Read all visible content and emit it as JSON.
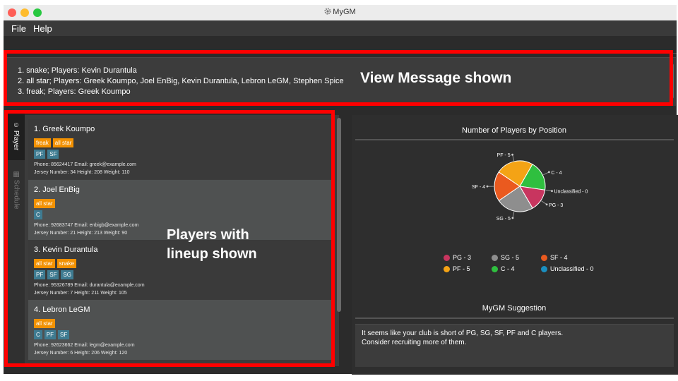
{
  "app": {
    "title": "MyGM",
    "icon": "gear-icon"
  },
  "menu": {
    "file": "File",
    "help": "Help"
  },
  "result": {
    "lines": "1. snake; Players: Kevin Durantula\n2. all star; Players: Greek Koumpo, Joel EnBig, Kevin Durantula, Lebron LeGM, Stephen Spice\n3. freak; Players: Greek Koumpo"
  },
  "annotations": {
    "view_message": "View Message shown",
    "players": "Players with\nlineup shown"
  },
  "sidebar": {
    "tabs": [
      {
        "label": "Player",
        "icon": "player-icon"
      },
      {
        "label": "Schedule",
        "icon": "schedule-icon"
      }
    ]
  },
  "players": [
    {
      "name": "1.  Greek Koumpo",
      "tags": [
        "freak",
        "all star"
      ],
      "positions": [
        "PF",
        "SF"
      ],
      "contact": "Phone: 85624417   Email: greek@example.com",
      "stats": "Jersey Number: 34   Height: 208   Weight: 110"
    },
    {
      "name": "2.  Joel EnBig",
      "tags": [
        "all star"
      ],
      "positions": [
        "C"
      ],
      "contact": "Phone: 92683747   Email: enbigb@example.com",
      "stats": "Jersey Number: 21   Height: 213   Weight: 90"
    },
    {
      "name": "3.  Kevin Durantula",
      "tags": [
        "all star",
        "snake"
      ],
      "positions": [
        "PF",
        "SF",
        "SG"
      ],
      "contact": "Phone: 95326789   Email: durantula@example.com",
      "stats": "Jersey Number: 7   Height: 211   Weight: 105"
    },
    {
      "name": "4.  Lebron LeGM",
      "tags": [
        "all star"
      ],
      "positions": [
        "C",
        "PF",
        "SF"
      ],
      "contact": "Phone: 92623662   Email: legm@example.com",
      "stats": "Jersey Number: 6   Height: 206   Weight: 120"
    }
  ],
  "chart_section_title": "Number of Players by Position",
  "chart_data": {
    "type": "pie",
    "title": "Number of Players by Position",
    "slices": [
      {
        "label": "C - 4",
        "value": 4,
        "color": "#2fbf3f"
      },
      {
        "label": "Unclassified - 0",
        "value": 0,
        "color": "#1a8fc0"
      },
      {
        "label": "PG - 3",
        "value": 3,
        "color": "#c8355f"
      },
      {
        "label": "SG - 5",
        "value": 5,
        "color": "#8e8e8e"
      },
      {
        "label": "SF - 4",
        "value": 4,
        "color": "#ea5a1f"
      },
      {
        "label": "PF - 5",
        "value": 5,
        "color": "#f4a315"
      }
    ],
    "legend": [
      {
        "label": "PG - 3",
        "color": "#c8355f"
      },
      {
        "label": "SG - 5",
        "color": "#8e8e8e"
      },
      {
        "label": "SF - 4",
        "color": "#ea5a1f"
      },
      {
        "label": "PF - 5",
        "color": "#f4a315"
      },
      {
        "label": "C - 4",
        "color": "#2fbf3f"
      },
      {
        "label": "Unclassified - 0",
        "color": "#1a8fc0"
      }
    ],
    "legend_position": "bottom"
  },
  "suggestion": {
    "title": "MyGM Suggestion",
    "text": "It seems like your club is short of PG, SG, SF, PF and C players.\nConsider recruiting more of them."
  }
}
